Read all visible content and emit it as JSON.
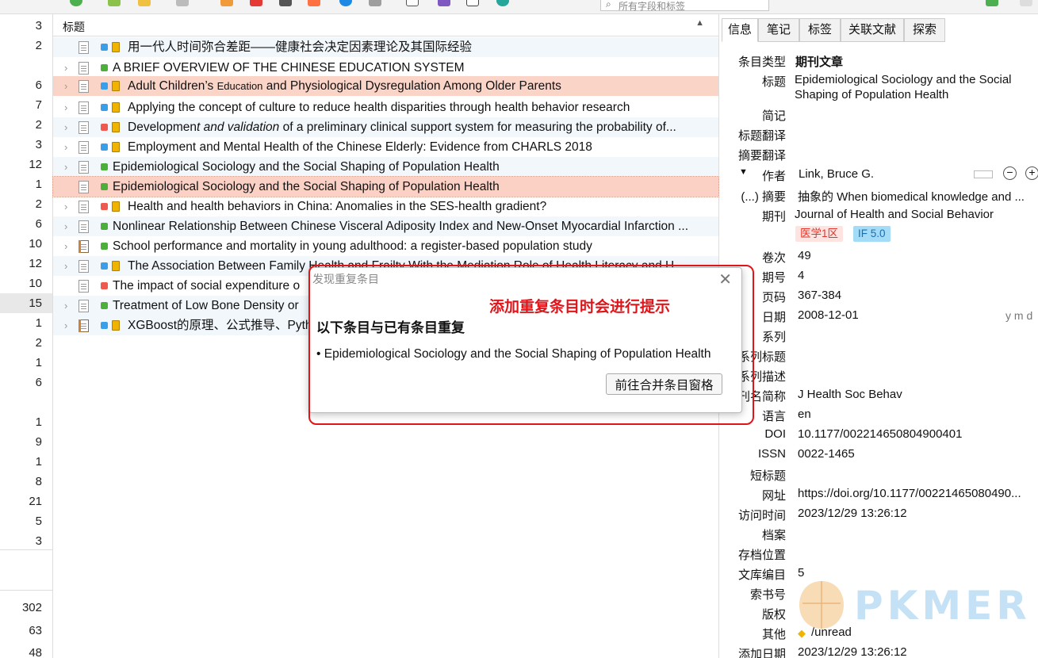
{
  "toolbar": {
    "search_placeholder": "所有字段和标签"
  },
  "counts": {
    "upper": [
      "3",
      "2",
      "",
      "6",
      "7",
      "2",
      "3",
      "12",
      "1",
      "2",
      "6",
      "10",
      "12",
      "10",
      "15",
      "1",
      "2",
      "1",
      "6",
      "",
      "1",
      "9",
      "1",
      "8",
      "21",
      "5",
      "3"
    ],
    "lower": [
      "302",
      "63",
      "48"
    ]
  },
  "items_pane": {
    "column_title": "标题",
    "sort_indicator": "▲",
    "rows": [
      {
        "title": "用一代人时间弥合差距——健康社会决定因素理论及其国际经验",
        "tag_color": "#3a9fe8",
        "note": true
      },
      {
        "title": "A BRIEF OVERVIEW OF THE CHINESE EDUCATION SYSTEM",
        "tag_color": "#4caf3a",
        "note": false
      },
      {
        "title_parts": [
          "Adult Children’s ",
          "Education",
          " and Physiological Dysregulation Among Older Parents"
        ],
        "tag_color": "#3a9fe8",
        "note": true
      },
      {
        "title": "Applying the concept of culture to reduce health disparities through health behavior research",
        "tag_color": "#3a9fe8",
        "note": true
      },
      {
        "title_parts": [
          "Developmen",
          "t and validation",
          " of a preliminary clinical support system for measuring the probability of..."
        ],
        "tag_color": "#ef5a50",
        "note": true
      },
      {
        "title": "Employment and Mental Health of the Chinese Elderly: Evidence from CHARLS 2018",
        "tag_color": "#3a9fe8",
        "note": true
      },
      {
        "title": "Epidemiological Sociology and the Social Shaping of Population Health",
        "tag_color": "#4caf3a",
        "note": false
      },
      {
        "title": "Epidemiological Sociology and the Social Shaping of Population Health",
        "tag_color": "#4caf3a",
        "note": false
      },
      {
        "title": "Health and health behaviors in China: Anomalies in the SES-health gradient?",
        "tag_color": "#ef5a50",
        "note": true
      },
      {
        "title": "Nonlinear Relationship Between Chinese Visceral Adiposity Index and New-Onset Myocardial Infarction ...",
        "tag_color": "#4caf3a",
        "note": false
      },
      {
        "title": "School performance and mortality in young adulthood: a register-based population study",
        "tag_color": "#4caf3a",
        "note": false
      },
      {
        "title": "The Association Between Family Health and Frailty With the Mediation Role of Health Literacy and H...",
        "tag_color": "#3a9fe8",
        "note": true
      },
      {
        "title": "The impact of social expenditure o",
        "tag_color": "#ef5a50",
        "note": false
      },
      {
        "title": "Treatment of Low Bone Density or",
        "tag_color": "#4caf3a",
        "note": false
      },
      {
        "title": "XGBoost的原理、公式推导、Pyth",
        "tag_color": "#3a9fe8",
        "note": true
      }
    ]
  },
  "right_pane": {
    "tabs": [
      "信息",
      "笔记",
      "标签",
      "关联文献",
      "探索"
    ],
    "fields": {
      "item_type_label": "条目类型",
      "item_type": "期刊文章",
      "title_label": "标题",
      "title": "Epidemiological Sociology and the Social Shaping of Population Health",
      "short_note_label": "简记",
      "title_trans_label": "标题翻译",
      "abstract_trans_label": "摘要翻译",
      "author_label": "作者",
      "author": "Link, Bruce G.",
      "abstract_label": "(...) 摘要",
      "abstract": "抽象的 When biomedical knowledge and ...",
      "journal_label": "期刊",
      "journal": "Journal of Health and Social Behavior",
      "badge_zone": "医学1区",
      "badge_if": "IF 5.0",
      "volume_label": "卷次",
      "volume": "49",
      "issue_label": "期号",
      "issue": "4",
      "pages_label": "页码",
      "pages": "367-384",
      "date_label": "日期",
      "date": "2008-12-01",
      "date_hint": "y m d",
      "series_label": "系列",
      "series_title_label": "系列标题",
      "series_desc_label": "系列描述",
      "journal_abbr_label": "刊名简称",
      "journal_abbr": "J Health Soc Behav",
      "language_label": "语言",
      "language": "en",
      "doi_label": "DOI",
      "doi": "10.1177/002214650804900401",
      "issn_label": "ISSN",
      "issn": "0022-1465",
      "short_title_label": "短标题",
      "url_label": "网址",
      "url": "https://doi.org/10.1177/00221465080490...",
      "accessed_label": "访问时间",
      "accessed": "2023/12/29 13:26:12",
      "archive_label": "档案",
      "archive_loc_label": "存档位置",
      "library_no_label": "文库编目",
      "library_no": "5",
      "call_no_label": "索书号",
      "rights_label": "版权",
      "extra_label": "其他",
      "extra": "/unread",
      "date_added_label": "添加日期",
      "date_added": "2023/12/29 13:26:12"
    }
  },
  "modal": {
    "title": "发现重复条目",
    "close": "✕",
    "heading": "以下条目与已有条目重复",
    "item": "• Epidemiological Sociology and the Social Shaping of Population Health",
    "button": "前往合并条目窗格"
  },
  "annotation": "添加重复条目时会进行提示",
  "watermark": {
    "text": "PKMER"
  },
  "colors": {
    "accent_red": "#e0151a",
    "selected_row": "#fcd1c5",
    "tag_blue": "#3a9fe8",
    "tag_green": "#4caf3a",
    "tag_red": "#ef5a50"
  }
}
